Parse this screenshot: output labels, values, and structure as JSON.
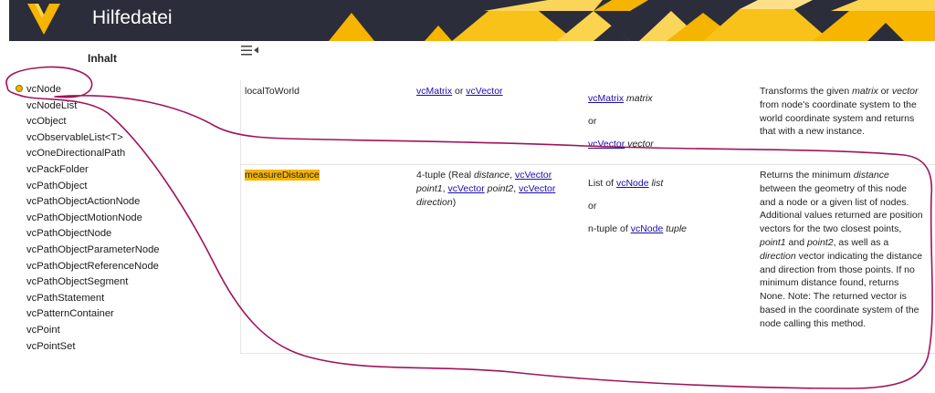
{
  "header": {
    "title": "Hilfedatei"
  },
  "sidebar": {
    "title": "Inhalt",
    "items": [
      {
        "label": "vcNode"
      },
      {
        "label": "vcNodeList"
      },
      {
        "label": "vcObject"
      },
      {
        "label": "vcObservableList<T>"
      },
      {
        "label": "vcOneDirectionalPath"
      },
      {
        "label": "vcPackFolder"
      },
      {
        "label": "vcPathObject"
      },
      {
        "label": "vcPathObjectActionNode"
      },
      {
        "label": "vcPathObjectMotionNode"
      },
      {
        "label": "vcPathObjectNode"
      },
      {
        "label": "vcPathObjectParameterNode"
      },
      {
        "label": "vcPathObjectReferenceNode"
      },
      {
        "label": "vcPathObjectSegment"
      },
      {
        "label": "vcPathStatement"
      },
      {
        "label": "vcPatternContainer"
      },
      {
        "label": "vcPoint"
      },
      {
        "label": "vcPointSet"
      }
    ],
    "active_index": 0
  },
  "table": {
    "rows": [
      {
        "name": "localToWorld",
        "return": {
          "link1": "vcMatrix",
          "or": "or",
          "link2": "vcVector"
        },
        "params": {
          "p1_link": "vcMatrix",
          "p1_name": "matrix",
          "or": "or",
          "p2_link": "vcVector",
          "p2_name": "vector"
        },
        "desc": {
          "t1": "Transforms the given ",
          "e1": "matrix",
          "t2": " or ",
          "e2": "vector",
          "t3": " from node's coordinate system to the world coordinate system and returns that with a new instance."
        }
      },
      {
        "name": "measureDistance",
        "return": {
          "t1": "4-tuple (Real ",
          "e1": "distance",
          "t2": ", ",
          "l1": "vcVector",
          "e2": "point1",
          "t3": ", ",
          "l2": "vcVector",
          "e3": "point2",
          "t4": ", ",
          "l3": "vcVector",
          "e4": "direction",
          "t5": ")"
        },
        "params": {
          "p1_pre": "List of ",
          "p1_link": "vcNode",
          "p1_name": "list",
          "or": "or",
          "p2_pre": "n-tuple of ",
          "p2_link": "vcNode",
          "p2_name": "tuple"
        },
        "desc": {
          "t1": "Returns the minimum ",
          "e1": "distance",
          "t2": " between the geometry of this node and a node or a given list of nodes. Additional values returned are position vectors for the two closest points, ",
          "e2": "point1",
          "t3": " and ",
          "e3": "point2",
          "t4": ", as well as a ",
          "e4": "direction",
          "t5": " vector indicating the distance and direction from those points.    If no minimum distance found, returns None.    Note: The returned vector is based in the coordinate system of the node calling this method."
        }
      }
    ]
  },
  "colors": {
    "header_bg": "#2b2d3a",
    "accent": "#f5b400",
    "link": "#1a0dab",
    "annotation": "#a0145a"
  },
  "icons": {
    "logo": "v-logo-icon",
    "toggle": "hamburger-collapse-icon"
  }
}
